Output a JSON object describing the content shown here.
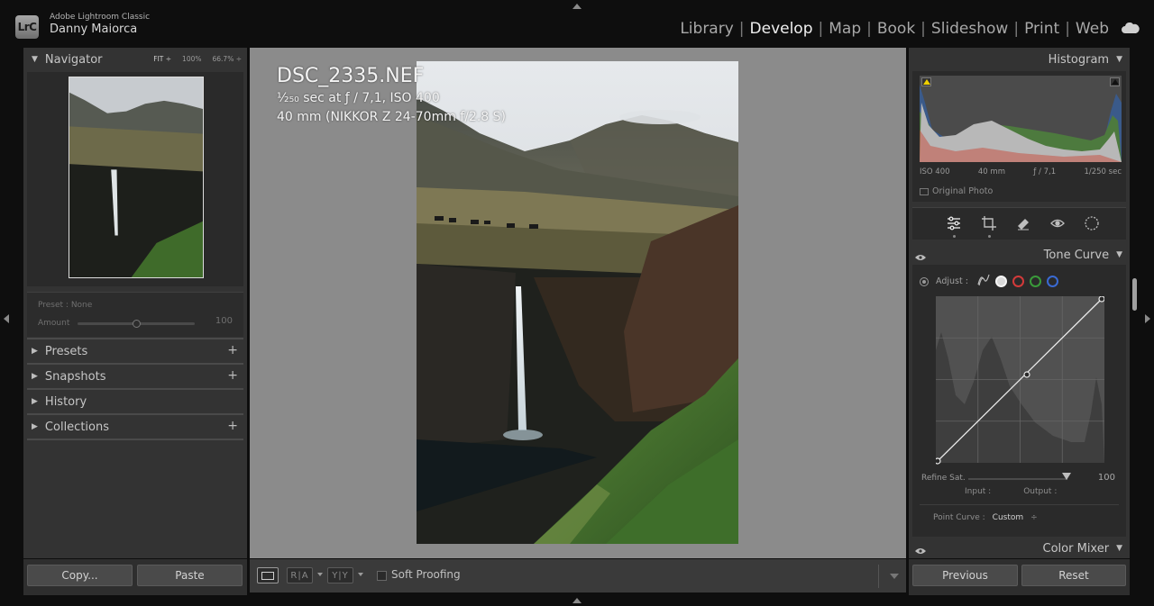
{
  "app": {
    "logo_text": "LrC",
    "app_name": "Adobe Lightroom Classic",
    "user_name": "Danny Maiorca"
  },
  "modules": [
    {
      "label": "Library",
      "active": false
    },
    {
      "label": "Develop",
      "active": true
    },
    {
      "label": "Map",
      "active": false
    },
    {
      "label": "Book",
      "active": false
    },
    {
      "label": "Slideshow",
      "active": false
    },
    {
      "label": "Print",
      "active": false
    },
    {
      "label": "Web",
      "active": false
    }
  ],
  "navigator": {
    "title": "Navigator",
    "zoom_fit": "FIT ÷",
    "zoom_100": "100%",
    "zoom_667": "66.7% ÷"
  },
  "quick_preset": {
    "preset_label": "Preset : None",
    "amount_label": "Amount",
    "amount_value": "100",
    "amount_fraction": 0.5
  },
  "left_panels": [
    {
      "label": "Presets",
      "has_plus": true
    },
    {
      "label": "Snapshots",
      "has_plus": true
    },
    {
      "label": "History",
      "has_plus": false
    },
    {
      "label": "Collections",
      "has_plus": true
    }
  ],
  "left_buttons": {
    "copy": "Copy...",
    "paste": "Paste"
  },
  "photo_info": {
    "file_name": "DSC_2335.NEF",
    "exposure": "¹⁄₂₅₀ sec at ƒ / 7,1, ISO 400",
    "lens": "40 mm (NIKKOR Z 24-70mm f/2.8 S)"
  },
  "toolbar": {
    "view_ra": "R|A",
    "view_yy": "Y|Y",
    "soft_proofing": "Soft Proofing"
  },
  "histogram": {
    "title": "Histogram",
    "iso": "ISO 400",
    "focal": "40 mm",
    "aperture": "ƒ / 7,1",
    "shutter": "1/250 sec",
    "original_photo": "Original Photo"
  },
  "tone_curve": {
    "title": "Tone Curve",
    "adjust_label": "Adjust :",
    "refine_label": "Refine Sat.",
    "refine_value": "100",
    "input_label": "Input :",
    "output_label": "Output :",
    "point_curve_label": "Point Curve :",
    "point_curve_value": "Custom",
    "channel_colors": [
      "#d9d9d9",
      "#d23a3a",
      "#3a9a3a",
      "#3a6ad2"
    ]
  },
  "color_mixer": {
    "title": "Color Mixer"
  },
  "right_buttons": {
    "previous": "Previous",
    "reset": "Reset"
  }
}
